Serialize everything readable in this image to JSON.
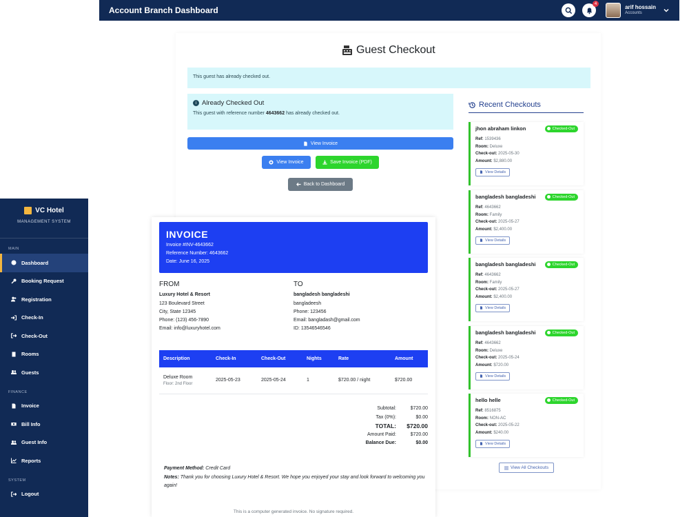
{
  "header": {
    "title": "Account Branch Dashboard",
    "notif_count": "4",
    "user_name": "arif hossain",
    "user_role": "Accounts"
  },
  "sidebar": {
    "brand": "VC Hotel",
    "brand_sub": "MANAGEMENT SYSTEM",
    "sections": {
      "main": "MAIN",
      "finance": "FINANCE",
      "system": "SYSTEM"
    },
    "items": [
      {
        "label": "Dashboard",
        "icon": "dashboard-icon"
      },
      {
        "label": "Booking Request",
        "icon": "key-icon"
      },
      {
        "label": "Registration",
        "icon": "user-plus-icon"
      },
      {
        "label": "Check-In",
        "icon": "sign-in-icon"
      },
      {
        "label": "Check-Out",
        "icon": "sign-out-icon"
      },
      {
        "label": "Rooms",
        "icon": "door-icon"
      },
      {
        "label": "Guests",
        "icon": "users-icon"
      },
      {
        "label": "Invoice",
        "icon": "file-icon"
      },
      {
        "label": "Bill Info",
        "icon": "money-icon"
      },
      {
        "label": "Guest Info",
        "icon": "users-icon"
      },
      {
        "label": "Reports",
        "icon": "chart-icon"
      },
      {
        "label": "Logout",
        "icon": "sign-out-icon"
      }
    ]
  },
  "checkout": {
    "title": "Guest Checkout",
    "banner": "This guest has already checked out.",
    "already_title": "Already Checked Out",
    "already_text_pre": "This guest with reference number",
    "already_ref": "4643662",
    "already_text_post": "has already checked out.",
    "btn_view_invoice_wide": "View Invoice",
    "btn_view_invoice": "View Invoice",
    "btn_save_pdf": "Save Invoice (PDF)",
    "btn_back": "Back to Dashboard"
  },
  "recent": {
    "title": "Recent Checkouts",
    "view_all": "View All Checkouts",
    "labels": {
      "ref": "Ref:",
      "room": "Room:",
      "checkout": "Check-out:",
      "amount": "Amount:",
      "details": "View Details",
      "badge": "Checked-Out"
    },
    "items": [
      {
        "name": "jhon abraham linkon",
        "ref": "1539436",
        "room": "Deluxe",
        "checkout": "2025-05-30",
        "amount": "$2,880.00"
      },
      {
        "name": "bangladesh bangladeshi",
        "ref": "4643662",
        "room": "Family",
        "checkout": "2025-05-27",
        "amount": "$2,400.00"
      },
      {
        "name": "bangladesh bangladeshi",
        "ref": "4643662",
        "room": "Family",
        "checkout": "2025-05-27",
        "amount": "$2,400.00"
      },
      {
        "name": "bangladesh bangladeshi",
        "ref": "4643662",
        "room": "Deluxe",
        "checkout": "2025-05-24",
        "amount": "$720.00"
      },
      {
        "name": "hello helle",
        "ref": "8516875",
        "room": "NON-AC",
        "checkout": "2025-05-22",
        "amount": "$240.00"
      }
    ]
  },
  "invoice": {
    "title": "INVOICE",
    "number": "Invoice #INV-4643662",
    "reference": "Reference Number: 4643662",
    "date": "Date: June 16, 2025",
    "from": {
      "heading": "FROM",
      "name": "Luxury Hotel & Resort",
      "lines": [
        "123 Boulevard Street",
        "City, State 12345",
        "Phone: (123) 456-7890",
        "Email: info@luxuryhotel.com"
      ]
    },
    "to": {
      "heading": "TO",
      "name": "bangladesh bangladeshi",
      "lines": [
        "bangladeesh",
        "Phone: 123456",
        "Email: bangladash@gmail.com",
        "ID: 13546546546"
      ]
    },
    "columns": [
      "Description",
      "Check-In",
      "Check-Out",
      "Nights",
      "Rate",
      "Amount"
    ],
    "row": {
      "description": "Deluxe Room",
      "floor": "Floor: 2nd Floor",
      "checkin": "2025-05-23",
      "checkout": "2025-05-24",
      "nights": "1",
      "rate": "$720.00 / night",
      "amount": "$720.00"
    },
    "totals": {
      "subtotal_label": "Subtotal:",
      "subtotal": "$720.00",
      "tax_label": "Tax (0%):",
      "tax": "$0.00",
      "total_label": "TOTAL:",
      "total": "$720.00",
      "paid_label": "Amount Paid:",
      "paid": "$720.00",
      "due_label": "Balance Due:",
      "due": "$0.00"
    },
    "payment_label": "Payment Method:",
    "payment_value": "Credit Card",
    "notes_label": "Notes:",
    "notes_value": "Thank you for choosing Luxury Hotel & Resort. We hope you enjoyed your stay and look forward to welcoming you again!",
    "footer": "This is a computer generated invoice. No signature required."
  },
  "colors": {
    "navy": "#112a55",
    "accent": "#f4b63f",
    "primary": "#1d3ff2",
    "success": "#2dd52d"
  }
}
